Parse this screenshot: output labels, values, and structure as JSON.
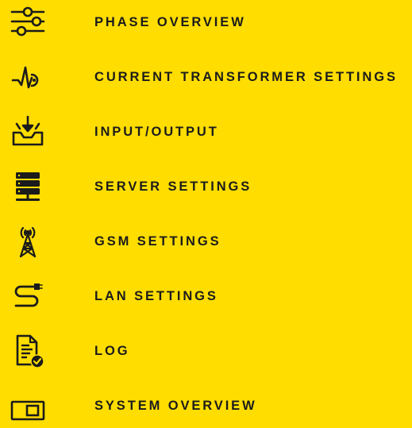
{
  "colors": {
    "background": "#FFDD00",
    "foreground": "#1B1B1B"
  },
  "menu": {
    "items": [
      {
        "id": "phase-overview",
        "label": "PHASE OVERVIEW",
        "icon": "sliders-icon"
      },
      {
        "id": "current-transformer-settings",
        "label": "CURRENT TRANSFORMER SETTINGS",
        "icon": "waveform-icon"
      },
      {
        "id": "input-output",
        "label": "INPUT/OUTPUT",
        "icon": "download-tray-icon"
      },
      {
        "id": "server-settings",
        "label": "SERVER SETTINGS",
        "icon": "server-icon"
      },
      {
        "id": "gsm-settings",
        "label": "GSM SETTINGS",
        "icon": "antenna-tower-icon"
      },
      {
        "id": "lan-settings",
        "label": "LAN SETTINGS",
        "icon": "ethernet-cable-icon"
      },
      {
        "id": "log",
        "label": "LOG",
        "icon": "document-check-icon"
      },
      {
        "id": "system-overview",
        "label": "SYSTEM OVERVIEW",
        "icon": "display-icon"
      }
    ]
  }
}
